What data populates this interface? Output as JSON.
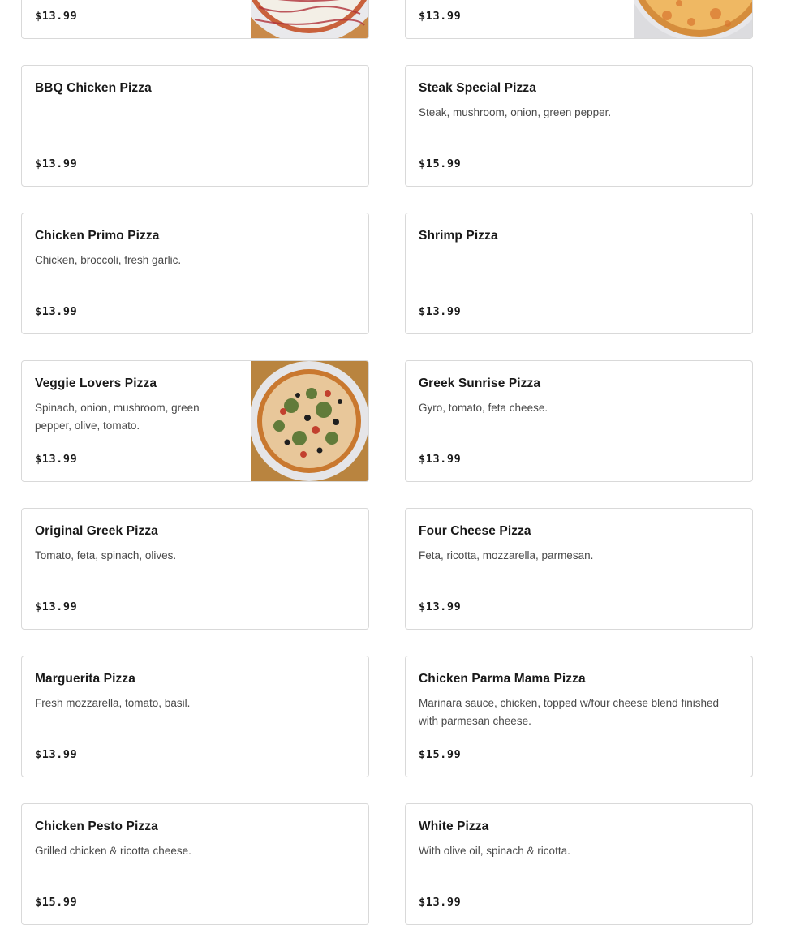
{
  "top_row": [
    {
      "price": "$13.99",
      "image": "pizza-photo-drizzle"
    },
    {
      "price": "$13.99",
      "image": "pizza-photo-cheese"
    }
  ],
  "menu_items": [
    {
      "name": "BBQ Chicken Pizza",
      "description": "",
      "price": "$13.99"
    },
    {
      "name": "Steak Special Pizza",
      "description": "Steak, mushroom, onion, green pepper.",
      "price": "$15.99"
    },
    {
      "name": "Chicken Primo Pizza",
      "description": "Chicken, broccoli, fresh garlic.",
      "price": "$13.99"
    },
    {
      "name": "Shrimp Pizza",
      "description": "",
      "price": "$13.99"
    },
    {
      "name": "Veggie Lovers Pizza",
      "description": "Spinach, onion, mushroom, green pepper, olive, tomato.",
      "price": "$13.99",
      "image": "pizza-photo-veggie"
    },
    {
      "name": "Greek Sunrise Pizza",
      "description": "Gyro, tomato, feta cheese.",
      "price": "$13.99"
    },
    {
      "name": "Original Greek Pizza",
      "description": "Tomato, feta, spinach, olives.",
      "price": "$13.99"
    },
    {
      "name": "Four Cheese Pizza",
      "description": "Feta, ricotta, mozzarella, parmesan.",
      "price": "$13.99"
    },
    {
      "name": "Marguerita Pizza",
      "description": "Fresh mozzarella, tomato, basil.",
      "price": "$13.99"
    },
    {
      "name": "Chicken Parma Mama Pizza",
      "description": "Marinara sauce, chicken, topped w/four cheese blend finished with parmesan cheese.",
      "price": "$15.99"
    },
    {
      "name": "Chicken Pesto Pizza",
      "description": "Grilled chicken & ricotta cheese.",
      "price": "$15.99"
    },
    {
      "name": "White Pizza",
      "description": "With olive oil, spinach & ricotta.",
      "price": "$13.99"
    }
  ]
}
